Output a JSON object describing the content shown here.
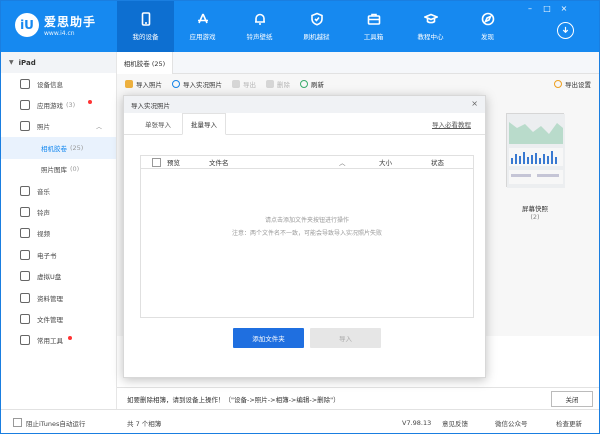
{
  "app": {
    "logo_mark": "iU",
    "name": "爱思助手",
    "url": "www.i4.cn",
    "brand_color": "#1689f0"
  },
  "nav": [
    {
      "label": "我的设备",
      "icon": "phone-icon",
      "active": true
    },
    {
      "label": "应用游戏",
      "icon": "app-store-icon"
    },
    {
      "label": "铃声壁纸",
      "icon": "bell-icon"
    },
    {
      "label": "刷机越狱",
      "icon": "shield-icon"
    },
    {
      "label": "工具箱",
      "icon": "toolbox-icon"
    },
    {
      "label": "教程中心",
      "icon": "graduation-cap-icon"
    },
    {
      "label": "发现",
      "icon": "compass-icon"
    }
  ],
  "sidebar": {
    "device": "iPad",
    "items": [
      {
        "label": "设备信息",
        "icon": "info-icon"
      },
      {
        "label": "应用游戏",
        "count": "(3)",
        "icon": "app-icon",
        "dot": true
      },
      {
        "label": "照片",
        "icon": "photo-icon",
        "expanded": true
      },
      {
        "label": "相机胶卷",
        "count": "(25)",
        "sub": true,
        "active": true
      },
      {
        "label": "照片图库",
        "count": "(0)",
        "sub": true
      },
      {
        "label": "音乐",
        "icon": "music-icon"
      },
      {
        "label": "铃声",
        "icon": "bell-icon"
      },
      {
        "label": "视频",
        "icon": "video-icon"
      },
      {
        "label": "电子书",
        "icon": "book-icon"
      },
      {
        "label": "虚拟U盘",
        "icon": "usb-icon"
      },
      {
        "label": "资料管理",
        "icon": "folder-icon"
      },
      {
        "label": "文件管理",
        "icon": "file-icon"
      },
      {
        "label": "常用工具",
        "icon": "tools-icon",
        "dot": true
      }
    ]
  },
  "main": {
    "tab": "相机胶卷 (25)",
    "toolbar": {
      "import_photo": "导入照片",
      "import_live": "导入实况照片",
      "export": "导出",
      "delete": "删除",
      "refresh": "刷新",
      "export_settings": "导出设置"
    },
    "photo": {
      "caption": "屏幕快照",
      "count": "(2)"
    },
    "notice": "如要删除相簿，请到设备上操作！（\"设备->照片->相簿->编辑->删除\"）",
    "close": "关闭"
  },
  "dialog": {
    "title": "导入实况照片",
    "tabs": [
      "单张导入",
      "批量导入"
    ],
    "help": "导入必看教程",
    "columns": {
      "preview": "预览",
      "filename": "文件名",
      "size": "大小",
      "status": "状态"
    },
    "empty_line1": "请点击添加文件夹按钮进行操作",
    "empty_line2": "注意：两个文件名不一致，可能会导致导入实况照片失败",
    "add_folder": "添加文件夹",
    "import": "导入"
  },
  "statusbar": {
    "itunes": "阻止iTunes自动运行",
    "albums": "共 7 个相簿",
    "version": "V7.98.13",
    "feedback": "意见反馈",
    "wechat": "微信公众号",
    "update": "检查更新"
  }
}
